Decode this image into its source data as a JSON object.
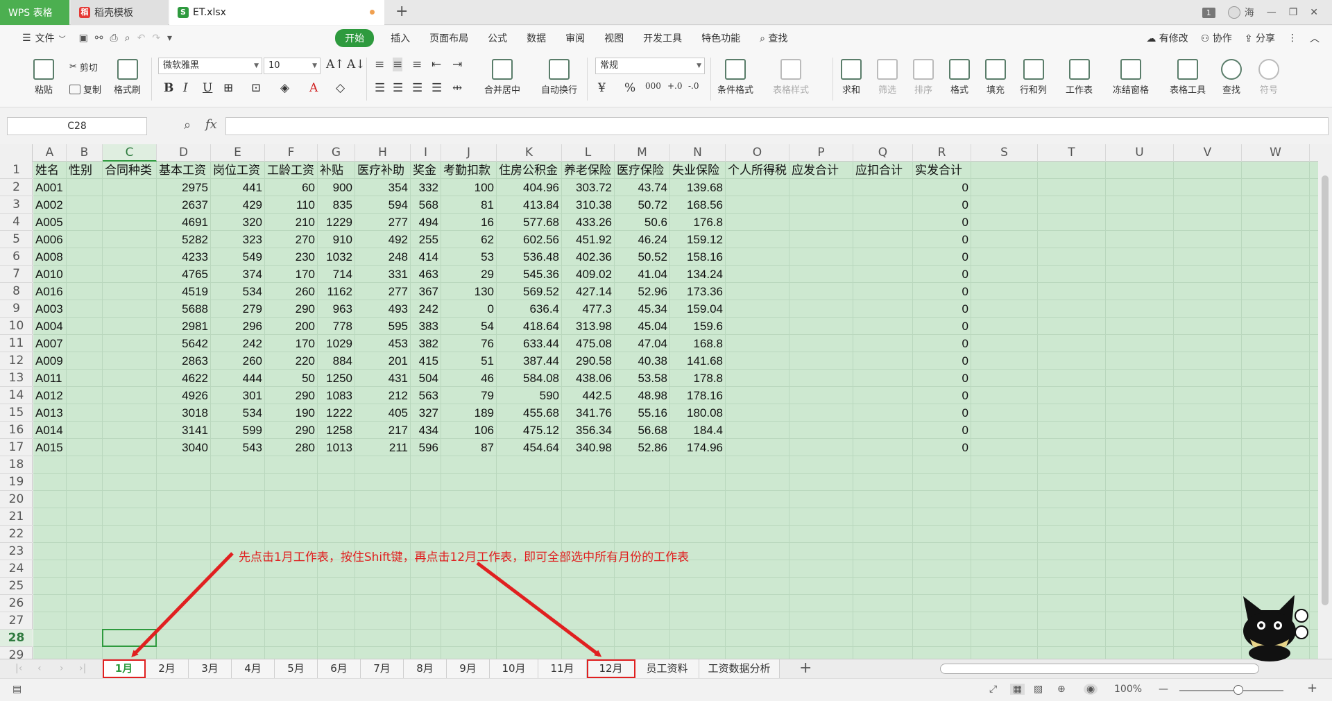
{
  "titlebar": {
    "tabs": [
      {
        "label": "WPS 表格"
      },
      {
        "label": "稻壳模板"
      },
      {
        "label": "ET.xlsx"
      }
    ],
    "window_badge": "1",
    "user": "海"
  },
  "menubar": {
    "file": "文件",
    "items": [
      "开始",
      "插入",
      "页面布局",
      "公式",
      "数据",
      "审阅",
      "视图",
      "开发工具",
      "特色功能"
    ],
    "search": "查找",
    "right": [
      "有修改",
      "协作",
      "分享"
    ]
  },
  "ribbon": {
    "paste": "粘贴",
    "cut": "剪切",
    "copy": "复制",
    "format_painter": "格式刷",
    "font_name": "微软雅黑",
    "font_size": "10",
    "merge_center": "合并居中",
    "auto_wrap": "自动换行",
    "number_format": "常规",
    "cond_format": "条件格式",
    "table_style": "表格样式",
    "sum": "求和",
    "filter": "筛选",
    "sort": "排序",
    "format": "格式",
    "fill": "填充",
    "row_col": "行和列",
    "worksheet": "工作表",
    "freeze": "冻结窗格",
    "table_tools": "表格工具",
    "find": "查找",
    "symbol": "符号"
  },
  "formula_bar": {
    "name_box": "C28",
    "fx": "fx",
    "formula": ""
  },
  "columns": [
    "A",
    "B",
    "C",
    "D",
    "E",
    "F",
    "G",
    "H",
    "I",
    "J",
    "K",
    "L",
    "M",
    "N",
    "O",
    "P",
    "Q",
    "R",
    "S",
    "T",
    "U",
    "V",
    "W"
  ],
  "row_numbers": [
    "1",
    "2",
    "3",
    "4",
    "5",
    "6",
    "7",
    "8",
    "9",
    "10",
    "11",
    "12",
    "13",
    "14",
    "15",
    "16",
    "17",
    "18",
    "19",
    "20",
    "21",
    "22",
    "23",
    "24",
    "25",
    "26",
    "27",
    "28",
    "29"
  ],
  "table": {
    "headers": [
      "姓名",
      "性别",
      "合同种类",
      "基本工资",
      "岗位工资",
      "工龄工资",
      "补贴",
      "医疗补助",
      "奖金",
      "考勤扣款",
      "住房公积金",
      "养老保险",
      "医疗保险",
      "失业保险",
      "个人所得税",
      "应发合计",
      "应扣合计",
      "实发合计"
    ],
    "rows": [
      [
        "A001",
        "",
        "",
        "2975",
        "441",
        "60",
        "900",
        "354",
        "332",
        "100",
        "404.96",
        "303.72",
        "43.74",
        "139.68",
        "",
        "",
        "",
        "0"
      ],
      [
        "A002",
        "",
        "",
        "2637",
        "429",
        "110",
        "835",
        "594",
        "568",
        "81",
        "413.84",
        "310.38",
        "50.72",
        "168.56",
        "",
        "",
        "",
        "0"
      ],
      [
        "A005",
        "",
        "",
        "4691",
        "320",
        "210",
        "1229",
        "277",
        "494",
        "16",
        "577.68",
        "433.26",
        "50.6",
        "176.8",
        "",
        "",
        "",
        "0"
      ],
      [
        "A006",
        "",
        "",
        "5282",
        "323",
        "270",
        "910",
        "492",
        "255",
        "62",
        "602.56",
        "451.92",
        "46.24",
        "159.12",
        "",
        "",
        "",
        "0"
      ],
      [
        "A008",
        "",
        "",
        "4233",
        "549",
        "230",
        "1032",
        "248",
        "414",
        "53",
        "536.48",
        "402.36",
        "50.52",
        "158.16",
        "",
        "",
        "",
        "0"
      ],
      [
        "A010",
        "",
        "",
        "4765",
        "374",
        "170",
        "714",
        "331",
        "463",
        "29",
        "545.36",
        "409.02",
        "41.04",
        "134.24",
        "",
        "",
        "",
        "0"
      ],
      [
        "A016",
        "",
        "",
        "4519",
        "534",
        "260",
        "1162",
        "277",
        "367",
        "130",
        "569.52",
        "427.14",
        "52.96",
        "173.36",
        "",
        "",
        "",
        "0"
      ],
      [
        "A003",
        "",
        "",
        "5688",
        "279",
        "290",
        "963",
        "493",
        "242",
        "0",
        "636.4",
        "477.3",
        "45.34",
        "159.04",
        "",
        "",
        "",
        "0"
      ],
      [
        "A004",
        "",
        "",
        "2981",
        "296",
        "200",
        "778",
        "595",
        "383",
        "54",
        "418.64",
        "313.98",
        "45.04",
        "159.6",
        "",
        "",
        "",
        "0"
      ],
      [
        "A007",
        "",
        "",
        "5642",
        "242",
        "170",
        "1029",
        "453",
        "382",
        "76",
        "633.44",
        "475.08",
        "47.04",
        "168.8",
        "",
        "",
        "",
        "0"
      ],
      [
        "A009",
        "",
        "",
        "2863",
        "260",
        "220",
        "884",
        "201",
        "415",
        "51",
        "387.44",
        "290.58",
        "40.38",
        "141.68",
        "",
        "",
        "",
        "0"
      ],
      [
        "A011",
        "",
        "",
        "4622",
        "444",
        "50",
        "1250",
        "431",
        "504",
        "46",
        "584.08",
        "438.06",
        "53.58",
        "178.8",
        "",
        "",
        "",
        "0"
      ],
      [
        "A012",
        "",
        "",
        "4926",
        "301",
        "290",
        "1083",
        "212",
        "563",
        "79",
        "590",
        "442.5",
        "48.98",
        "178.16",
        "",
        "",
        "",
        "0"
      ],
      [
        "A013",
        "",
        "",
        "3018",
        "534",
        "190",
        "1222",
        "405",
        "327",
        "189",
        "455.68",
        "341.76",
        "55.16",
        "180.08",
        "",
        "",
        "",
        "0"
      ],
      [
        "A014",
        "",
        "",
        "3141",
        "599",
        "290",
        "1258",
        "217",
        "434",
        "106",
        "475.12",
        "356.34",
        "56.68",
        "184.4",
        "",
        "",
        "",
        "0"
      ],
      [
        "A015",
        "",
        "",
        "3040",
        "543",
        "280",
        "1013",
        "211",
        "596",
        "87",
        "454.64",
        "340.98",
        "52.86",
        "174.96",
        "",
        "",
        "",
        "0"
      ]
    ]
  },
  "annotation": "先点击1月工作表，按住Shift键，再点击12月工作表，即可全部选中所有月份的工作表",
  "sheets": [
    "1月",
    "2月",
    "3月",
    "4月",
    "5月",
    "6月",
    "7月",
    "8月",
    "9月",
    "10月",
    "11月",
    "12月",
    "员工资料",
    "工资数据分析"
  ],
  "status": {
    "zoom": "100%"
  },
  "colors": {
    "accent": "#2e9a3e",
    "cell_bg": "#cde8d0",
    "annotation": "#e02020"
  }
}
